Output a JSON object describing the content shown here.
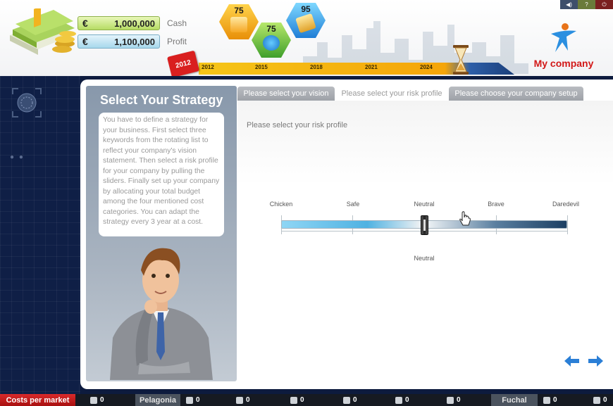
{
  "header": {
    "cash": {
      "currency": "€",
      "value": "1,000,000",
      "label": "Cash"
    },
    "profit": {
      "currency": "€",
      "value": "1,100,000",
      "label": "Profit"
    },
    "badges": [
      {
        "value": "75",
        "icon": "people-icon",
        "color": "#f5a623"
      },
      {
        "value": "75",
        "icon": "globe-icon",
        "color": "#5cb531"
      },
      {
        "value": "95",
        "icon": "money-icon",
        "color": "#2b8fe0"
      }
    ],
    "current_year": "2012",
    "timeline_ticks": [
      "2012",
      "2015",
      "2018",
      "2021",
      "2024"
    ],
    "company_name": "My company",
    "brand_color": "#d21818"
  },
  "strategy": {
    "title": "Select Your Strategy",
    "description": "You have to define a strategy for your business. First select three keywords from the rotating list to reflect your company's vision statement. Then select a risk profile for your company by pulling the sliders. Finally set up your company by allocating your total budget among the four mentioned cost categories. You can adapt the strategy every 3 year at a cost."
  },
  "tabs": [
    {
      "label": "Please select your vision"
    },
    {
      "label": "Please select your risk profile"
    },
    {
      "label": "Please choose your company setup"
    }
  ],
  "risk": {
    "prompt": "Please select your risk profile",
    "levels": [
      "Chicken",
      "Safe",
      "Neutral",
      "Brave",
      "Daredevil"
    ],
    "selected": "Neutral",
    "selected_index": 2
  },
  "bottom_bar": {
    "costs_label": "Costs per market",
    "items": [
      {
        "icon": "umbrella-icon",
        "value": "0"
      },
      {
        "region": "Pelagonia"
      },
      {
        "icon": "gear-icon",
        "value": "0"
      },
      {
        "icon": "factory-icon",
        "value": "0"
      },
      {
        "icon": "recycle-icon",
        "value": "0"
      },
      {
        "icon": "tool-icon",
        "value": "0"
      },
      {
        "icon": "people-icon",
        "value": "0"
      },
      {
        "icon": "umbrella-icon",
        "value": "0"
      },
      {
        "region": "Fuchal"
      },
      {
        "icon": "gear-icon",
        "value": "0"
      },
      {
        "icon": "factory-icon",
        "value": "0"
      }
    ]
  }
}
